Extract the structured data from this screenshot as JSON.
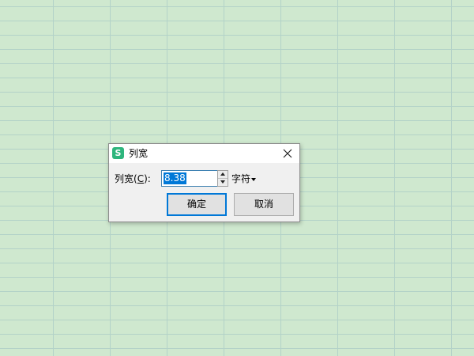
{
  "dialog": {
    "title": "列宽",
    "app_icon_glyph": "S",
    "app_icon_color": "#2eb67d",
    "label_prefix": "列宽(",
    "label_accel": "C",
    "label_suffix": "):",
    "width_value": "8.38",
    "unit_label": "字符",
    "ok_label": "确定",
    "cancel_label": "取消"
  },
  "icons": {
    "close": "close-icon",
    "spin_up": "chevron-up-icon",
    "spin_down": "chevron-down-icon",
    "unit_caret": "caret-down-icon"
  },
  "colors": {
    "sheet_background": "#cfe8cf",
    "grid_line": "#b3d2c8",
    "selection": "#0078d7",
    "focus_border": "#0078d7"
  }
}
